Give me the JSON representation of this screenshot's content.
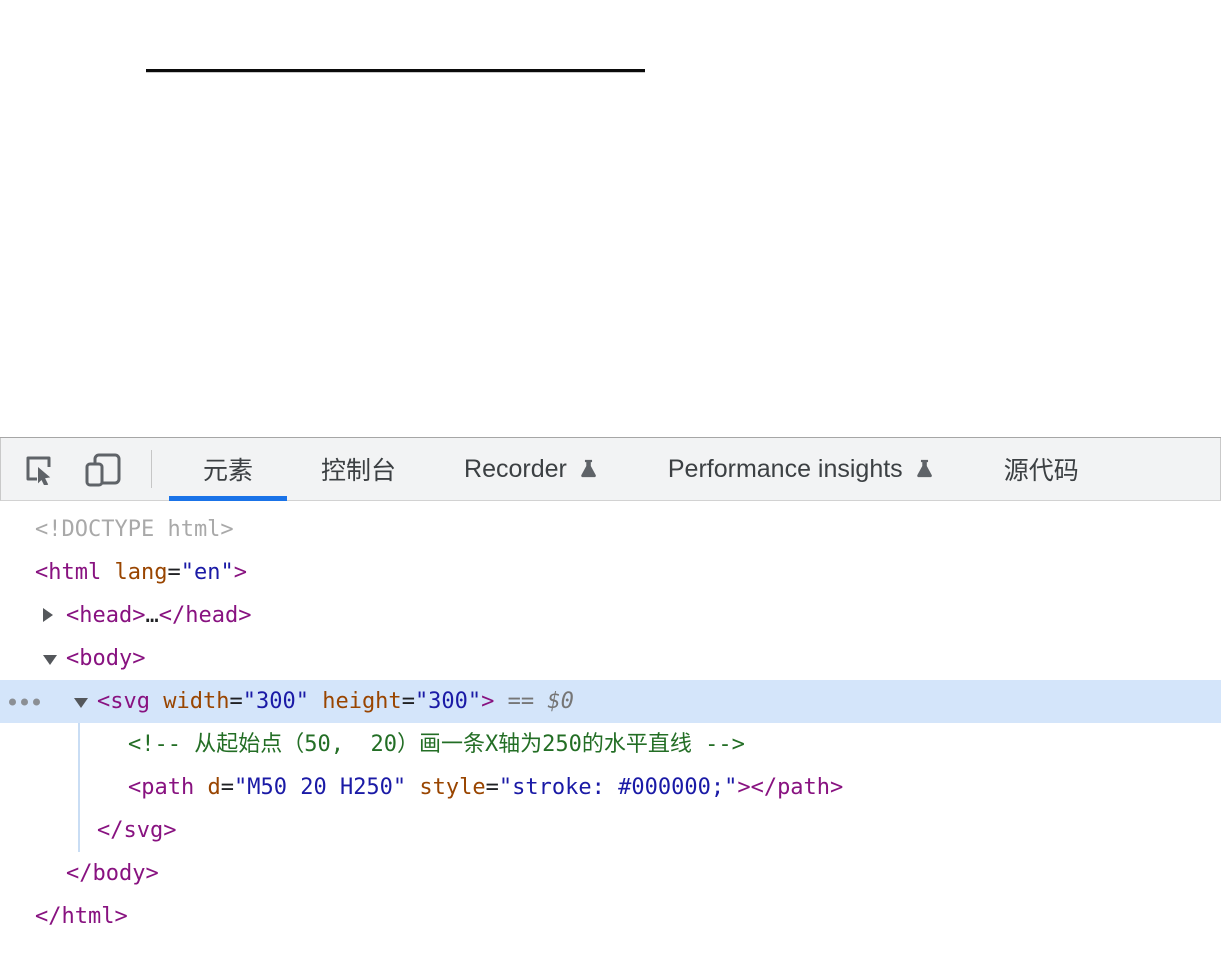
{
  "rendered_page": {
    "svg_line": {
      "color": "#000000",
      "description": "horizontal black line drawn by svg path"
    }
  },
  "devtools": {
    "toolbar": {
      "accent_color": "#1a73e8",
      "icon_color": "#5f6368",
      "tabs": [
        {
          "name": "tab-elements",
          "label": "元素",
          "active": true,
          "flask": false
        },
        {
          "name": "tab-console",
          "label": "控制台",
          "active": false,
          "flask": false
        },
        {
          "name": "tab-recorder",
          "label": "Recorder",
          "active": false,
          "flask": true
        },
        {
          "name": "tab-performance-insights",
          "label": "Performance insights",
          "active": false,
          "flask": true
        },
        {
          "name": "tab-sources",
          "label": "源代码",
          "active": false,
          "flask": false
        }
      ]
    },
    "colors": {
      "tag": "#881280",
      "attr": "#994500",
      "val": "#1a1aa6",
      "com": "#236e25",
      "grey": "#a9a9a9",
      "meta": "#767676",
      "plain": "#202124",
      "selected_bg": "#d4e5fa"
    },
    "tree": {
      "rows": [
        {
          "level": 0,
          "tokens": [
            {
              "c": "grey",
              "t": "<!DOCTYPE html>"
            }
          ]
        },
        {
          "level": 0,
          "tokens": [
            {
              "c": "tag",
              "t": "<html "
            },
            {
              "c": "attr",
              "t": "lang"
            },
            {
              "c": "plain",
              "t": "="
            },
            {
              "c": "val",
              "t": "\"en\""
            },
            {
              "c": "tag",
              "t": ">"
            }
          ]
        },
        {
          "level": 1,
          "exp": "closed",
          "tokens": [
            {
              "c": "tag",
              "t": "<head>"
            },
            {
              "c": "plain",
              "t": "…"
            },
            {
              "c": "tag",
              "t": "</head>"
            }
          ]
        },
        {
          "level": 1,
          "exp": "open",
          "tokens": [
            {
              "c": "tag",
              "t": "<body>"
            }
          ]
        },
        {
          "level": 2,
          "exp": "open",
          "selected": true,
          "dots": true,
          "tokens": [
            {
              "c": "tag",
              "t": "<svg "
            },
            {
              "c": "attr",
              "t": "width"
            },
            {
              "c": "plain",
              "t": "="
            },
            {
              "c": "val",
              "t": "\"300\""
            },
            {
              "c": "plain",
              "t": " "
            },
            {
              "c": "attr",
              "t": "height"
            },
            {
              "c": "plain",
              "t": "="
            },
            {
              "c": "val",
              "t": "\"300\""
            },
            {
              "c": "tag",
              "t": ">"
            },
            {
              "c": "meta",
              "t": " == $0"
            }
          ]
        },
        {
          "level": 3,
          "tokens": [
            {
              "c": "com",
              "t": "<!-- 从起始点（50,  20）画一条X轴为250的水平直线 -->"
            }
          ]
        },
        {
          "level": 3,
          "tokens": [
            {
              "c": "tag",
              "t": "<path "
            },
            {
              "c": "attr",
              "t": "d"
            },
            {
              "c": "plain",
              "t": "="
            },
            {
              "c": "val",
              "t": "\"M50 20 H250\""
            },
            {
              "c": "plain",
              "t": " "
            },
            {
              "c": "attr",
              "t": "style"
            },
            {
              "c": "plain",
              "t": "="
            },
            {
              "c": "val",
              "t": "\"stroke: #000000;\""
            },
            {
              "c": "tag",
              "t": "></path>"
            }
          ]
        },
        {
          "level": 2,
          "tokens": [
            {
              "c": "tag",
              "t": "</svg>"
            }
          ]
        },
        {
          "level": 1,
          "tokens": [
            {
              "c": "tag",
              "t": "</body>"
            }
          ]
        },
        {
          "level": 0,
          "tokens": [
            {
              "c": "tag",
              "t": "</html>"
            }
          ]
        }
      ]
    }
  }
}
